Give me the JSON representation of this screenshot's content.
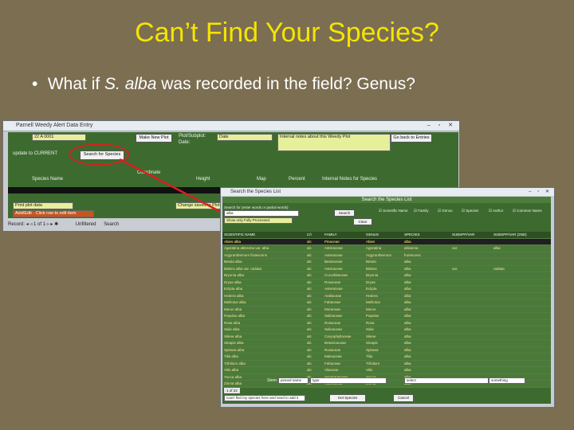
{
  "slide": {
    "title": "Can’t Find Your Species?",
    "bullet": {
      "pre": "What if ",
      "italic": "S. alba",
      "post": " was recorded in the field?  Genus?"
    }
  },
  "window1": {
    "title": "Parnell Weedy Alert Data Entry",
    "id_value": "22 A 0001",
    "make_new_plot": "Make New Plot",
    "plot_label": "Plot/Subplot:",
    "date_label": "Date:",
    "date_label2": "Date",
    "internal_notes": "Internal notes about this Weedy Plot",
    "go_back": "Go back to Entries",
    "update_label": "update to CURRENT",
    "search_species": "Search for Species",
    "species_name": "Species Name",
    "header_cols": [
      "Coordinate",
      "Height",
      "Map",
      "Percent",
      "Internal Notes for Species"
    ],
    "print_data": "Print plot data",
    "changes_label": "Change saved to Plots",
    "add_edit": "Add/Edit · Click row to edit item",
    "nav_record": "Record:",
    "nav_of": "1 of 1",
    "nav_unfiltered": "Unfiltered",
    "nav_search": "Search"
  },
  "window2": {
    "title": "Search the Species List",
    "header": "Search the Species List",
    "search_label": "Search for (enter words or partial words)",
    "search_value": "alba",
    "search_button": "Search",
    "show_fully": "Show only Fully Processed",
    "clear_button": "Clear",
    "checkboxes": [
      "Scientific Name",
      "Family",
      "Genus",
      "Species",
      "Author",
      "Common Name"
    ],
    "columns": [
      "SCIENTIFIC NAME",
      "C/I",
      "FAMILY",
      "GENUS",
      "SPECIES",
      "SUBSPP/VAR",
      "SUBSPP/VAR (2ND)"
    ],
    "rows": [
      [
        "Abies alba",
        "alc",
        "Pinaceae",
        "Abies",
        "alba",
        "",
        ""
      ],
      [
        "Ageratina altissima var. alba",
        "alc",
        "Asteraceae",
        "Ageratina",
        "altissima",
        "var.",
        "alba"
      ],
      [
        "Argyranthemum frutescens",
        "alc",
        "Asteraceae",
        "Argyranthemum",
        "frutescens",
        "",
        ""
      ],
      [
        "Betula alba",
        "alc",
        "Betulaceae",
        "Betula",
        "alba",
        "",
        ""
      ],
      [
        "Bidens alba var. radiata",
        "alc",
        "Asteraceae",
        "Bidens",
        "alba",
        "var.",
        "radiata"
      ],
      [
        "Bryonia alba",
        "alc",
        "Cucurbitaceae",
        "Bryonia",
        "alba",
        "",
        ""
      ],
      [
        "Dryas alba",
        "alc",
        "Rosaceae",
        "Dryas",
        "alba",
        "",
        ""
      ],
      [
        "Eclipta alba",
        "alc",
        "Asteraceae",
        "Eclipta",
        "alba",
        "",
        ""
      ],
      [
        "Hedera alba",
        "alc",
        "Araliaceae",
        "Hedera",
        "alba",
        "",
        ""
      ],
      [
        "Melilotus alba",
        "alc",
        "Fabaceae",
        "Melilotus",
        "alba",
        "",
        ""
      ],
      [
        "Morus alba",
        "alc",
        "Moraceae",
        "Morus",
        "alba",
        "",
        ""
      ],
      [
        "Populus alba",
        "alc",
        "Salicaceae",
        "Populus",
        "alba",
        "",
        ""
      ],
      [
        "Rosa alba",
        "alc",
        "Rosaceae",
        "Rosa",
        "alba",
        "",
        ""
      ],
      [
        "Salix alba",
        "alc",
        "Salicaceae",
        "Salix",
        "alba",
        "",
        ""
      ],
      [
        "Silene alba",
        "alc",
        "Caryophyllaceae",
        "Silene",
        "alba",
        "",
        ""
      ],
      [
        "Sinapis alba",
        "alc",
        "Brassicaceae",
        "Sinapis",
        "alba",
        "",
        ""
      ],
      [
        "Spiraea alba",
        "alc",
        "Rosaceae",
        "Spiraea",
        "alba",
        "",
        ""
      ],
      [
        "Tilia alba",
        "alc",
        "Malvaceae",
        "Tilia",
        "alba",
        "",
        ""
      ],
      [
        "Trifolium alba",
        "alc",
        "Fabaceae",
        "Trifolium",
        "alba",
        "",
        ""
      ],
      [
        "Vitis alba",
        "alc",
        "Vitaceae",
        "Vitis",
        "alba",
        "",
        ""
      ],
      [
        "Yucca alba",
        "alc",
        "Asparagaceae",
        "Yucca",
        "alba",
        "",
        ""
      ],
      [
        "Zinnia alba",
        "alc",
        "Asteraceae",
        "Zinnia",
        "alba",
        "",
        ""
      ]
    ],
    "bottom_label": "Stem:",
    "bottom_box": "pinned name",
    "bottom_search1": "type",
    "bottom_search2": "select",
    "bottom_search3": "something",
    "footer_text": "Can't find my species here and need to add it",
    "get_species": "Get Species",
    "cancel": "Cancel",
    "footer_nav": "1 of 22"
  }
}
